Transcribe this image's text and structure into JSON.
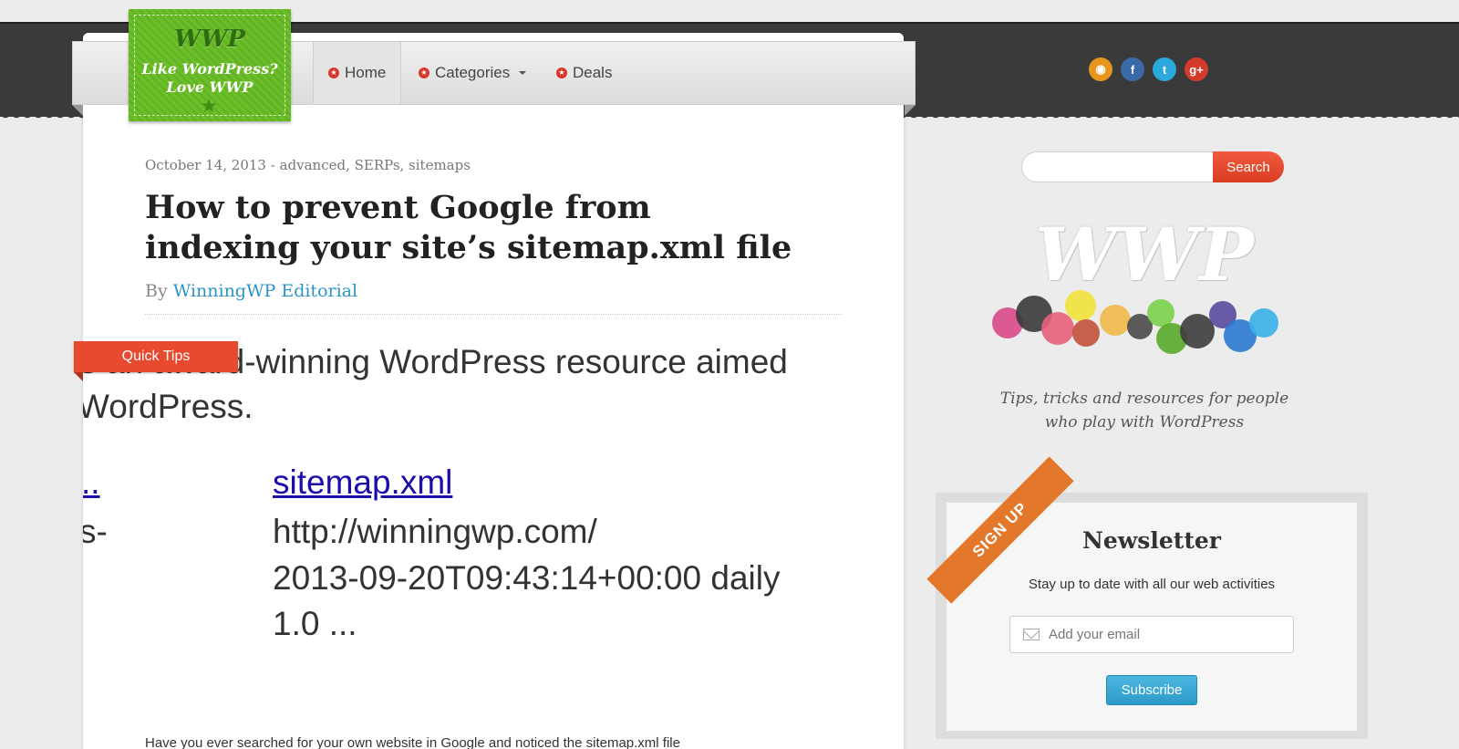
{
  "header": {
    "logo": {
      "title": "WWP",
      "line1": "Like WordPress?",
      "line2": "Love WWP"
    },
    "nav": [
      {
        "label": "Home",
        "icon": "star-icon",
        "active": true
      },
      {
        "label": "Categories",
        "icon": "star-icon",
        "dropdown": true
      },
      {
        "label": "Deals",
        "icon": "star-icon"
      }
    ],
    "social": [
      {
        "icon": "rss-icon",
        "glyph": "◉",
        "color": "#e8951d"
      },
      {
        "icon": "facebook-icon",
        "glyph": "f",
        "color": "#3b6aa8"
      },
      {
        "icon": "twitter-icon",
        "glyph": "t",
        "color": "#2ba9dc"
      },
      {
        "icon": "google-plus-icon",
        "glyph": "g+",
        "color": "#d63a2a"
      }
    ]
  },
  "post": {
    "meta": "October 14, 2013 - advanced, SERPs, sitemaps",
    "title": "How to prevent Google from indexing your site’s sitemap.xml file",
    "byline_prefix": "By",
    "author": "WinningWP Editorial",
    "category_ribbon": "Quick Tips",
    "screenshot": {
      "line1": "is an award-winning WordPress resource aimed",
      "line2": "WordPress.",
      "left_link": "..",
      "left_fragment": "s-",
      "result_link": "sitemap.xml",
      "result_url": "http://winningwp.com/",
      "result_line1": "2013-09-20T09:43:14+00:00 daily",
      "result_line2": "1.0 ..."
    },
    "excerpt": "Have you ever searched for your own website in Google and noticed the sitemap.xml file"
  },
  "sidebar": {
    "search": {
      "placeholder": "",
      "button_label": "Search"
    },
    "logo": {
      "mark": "WWP",
      "tagline_line1": "Tips, tricks and resources for people",
      "tagline_line2": "who play with WordPress"
    },
    "newsletter": {
      "ribbon": "SIGN UP",
      "title": "Newsletter",
      "subtitle": "Stay up to date with all our web activities",
      "email_placeholder": "Add your email",
      "button_label": "Subscribe"
    }
  },
  "colors": {
    "accent_red": "#e74a2e",
    "link_blue": "#2a94c6",
    "logo_green": "#6cbf2a",
    "signup_orange": "#e4782a",
    "subscribe_blue": "#2c9bc9"
  }
}
